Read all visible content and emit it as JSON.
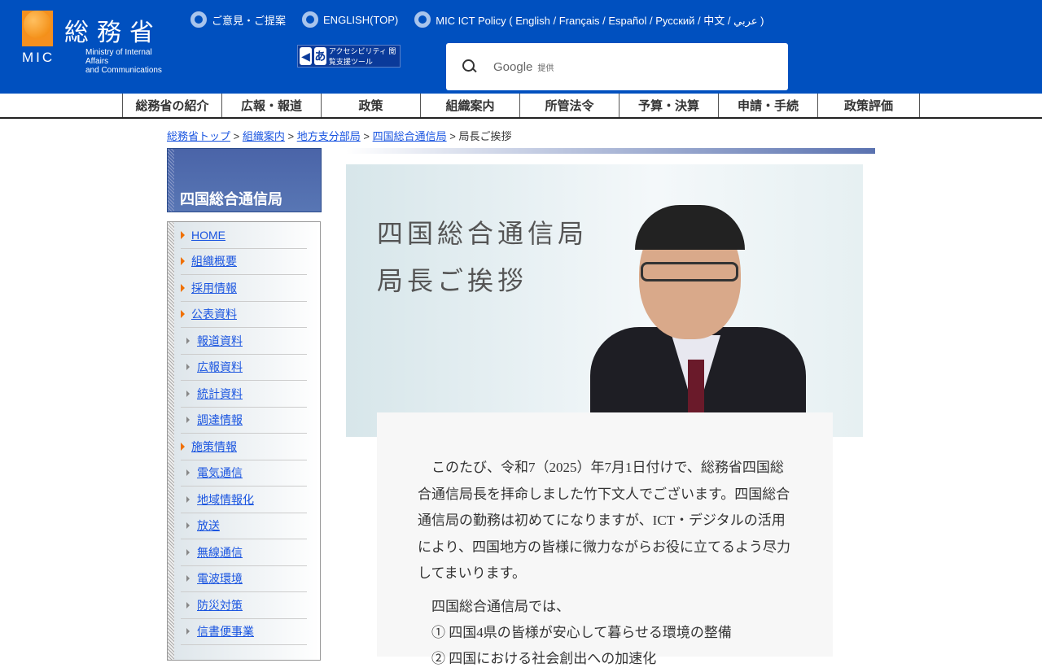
{
  "header": {
    "logo_kanji": "総務省",
    "logo_abbr": "MIC",
    "logo_en": [
      "Ministry of Internal Affairs",
      "and Communications"
    ],
    "links": [
      "ご意見・ご提案",
      "ENGLISH(TOP)",
      "MIC ICT Policy ( English / Français / Español / Русский / 中文 / عربي )"
    ],
    "accessibility_label": "アクセシビリティ 閲覧支援ツール",
    "search": {
      "brand": "Google",
      "provided": "提供"
    }
  },
  "gnav": [
    "総務省の紹介",
    "広報・報道",
    "政策",
    "組織案内",
    "所管法令",
    "予算・決算",
    "申請・手続",
    "政策評価"
  ],
  "breadcrumb": {
    "links": [
      "総務省トップ",
      "組織案内",
      "地方支分部局",
      "四国総合通信局"
    ],
    "current": "局長ご挨拶",
    "sep": ">"
  },
  "sidebar": {
    "title": "四国総合通信局",
    "items": [
      {
        "label": "HOME",
        "sub": false
      },
      {
        "label": "組織概要",
        "sub": false
      },
      {
        "label": "採用情報",
        "sub": false
      },
      {
        "label": "公表資料",
        "sub": false
      },
      {
        "label": "報道資料",
        "sub": true
      },
      {
        "label": "広報資料",
        "sub": true
      },
      {
        "label": "統計資料",
        "sub": true
      },
      {
        "label": "調達情報",
        "sub": true
      },
      {
        "label": "施策情報",
        "sub": false
      },
      {
        "label": "電気通信",
        "sub": true
      },
      {
        "label": "地域情報化",
        "sub": true
      },
      {
        "label": "放送",
        "sub": true
      },
      {
        "label": "無線通信",
        "sub": true
      },
      {
        "label": "電波環境",
        "sub": true
      },
      {
        "label": "防災対策",
        "sub": true
      },
      {
        "label": "信書便事業",
        "sub": true
      }
    ]
  },
  "hero": {
    "line1": "四国総合通信局",
    "line2": "局長ご挨拶"
  },
  "body": {
    "para1": "このたび、令和7（2025）年7月1日付けで、総務省四国総合通信局長を拝命しました竹下文人でございます。四国総合通信局の勤務は初めてになりますが、ICT・デジタルの活用により、四国地方の皆様に微力ながらお役に立てるよう尽力してまいります。",
    "para2": "四国総合通信局では、",
    "item1": "① 四国4県の皆様が安心して暮らせる環境の整備",
    "item2": "② 四国における社会創出への加速化"
  }
}
